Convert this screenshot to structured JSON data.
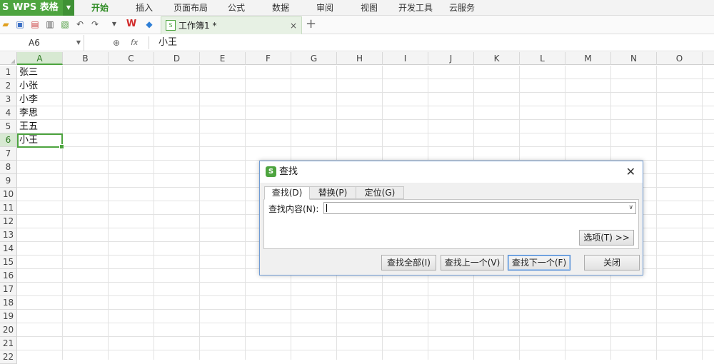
{
  "menubar": {
    "app_logo": "S",
    "app_name": "WPS 表格",
    "items": [
      "开始",
      "插入",
      "页面布局",
      "公式",
      "数据",
      "审阅",
      "视图",
      "开发工具",
      "云服务"
    ],
    "active_index": 0
  },
  "toolbar": {
    "icons": [
      "open-icon",
      "save-icon",
      "export-icon",
      "print-icon",
      "preview-icon",
      "undo-icon",
      "redo-icon",
      "dropdown-icon",
      "wps-logo-icon",
      "cube-icon"
    ],
    "doc_tab_label": "工作簿1 *",
    "tab_close": "×",
    "new_tab": "+"
  },
  "formula_bar": {
    "cell_ref": "A6",
    "fx": "fx",
    "content": "小王"
  },
  "grid": {
    "columns": [
      "A",
      "B",
      "C",
      "D",
      "E",
      "F",
      "G",
      "H",
      "I",
      "J",
      "K",
      "L",
      "M",
      "N",
      "O"
    ],
    "rows": [
      "1",
      "2",
      "3",
      "4",
      "5",
      "6",
      "7",
      "8",
      "9",
      "10",
      "11",
      "12",
      "13",
      "14",
      "15",
      "16",
      "17",
      "18",
      "19",
      "20",
      "21",
      "22"
    ],
    "selected_column": "A",
    "selected_row": "6",
    "cells_A": [
      "张三",
      "小张",
      "小李",
      "李思",
      "王五",
      "小王"
    ]
  },
  "dialog": {
    "logo": "S",
    "title": "查找",
    "close": "✕",
    "tabs": [
      "查找(D)",
      "替换(P)",
      "定位(G)"
    ],
    "active_tab": 0,
    "find_label": "查找内容(N):",
    "find_value": "",
    "options_button": "选项(T) >>",
    "buttons": [
      "查找全部(I)",
      "查找上一个(V)",
      "查找下一个(F)",
      "关闭"
    ],
    "default_button_index": 2
  }
}
